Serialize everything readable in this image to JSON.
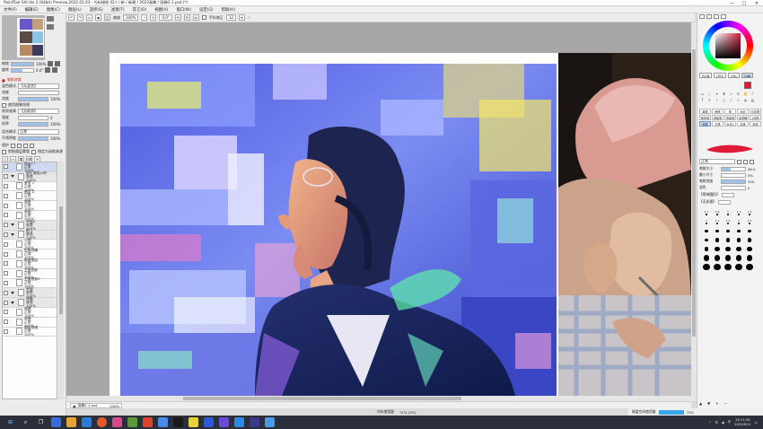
{
  "titlebar": {
    "title": "PaintTool SAI Ver.2 (64bit) Preview.2022.01.03 - 光标描绘 (D:) / 新 / 新建 / 2022画稿 / 画稿2-1.psd (*)",
    "minimize": "—",
    "maximize": "□",
    "close": "✕"
  },
  "menu": [
    "文件(F)",
    "编辑(E)",
    "图像(C)",
    "图层(L)",
    "选择(S)",
    "滤镜(T)",
    "其它(O)",
    "视图(V)",
    "窗口(W)",
    "设定(G)",
    "帮助(H)"
  ],
  "toolbar": {
    "zoom_label": "缩放",
    "zoom_value": "100%",
    "angle_value": "0.0°",
    "stabilizer_label": "手抖修正",
    "stabilizer_value": "12"
  },
  "left_panel": {
    "rows": [
      {
        "label": "缩放",
        "value": "100%"
      },
      {
        "label": "旋转",
        "value": "0.0°"
      }
    ],
    "brush_header": "笔刷浓度",
    "settings": [
      {
        "label": "混色模式",
        "value": "【无混合】"
      },
      {
        "label": "浓度",
        "value": ""
      },
      {
        "label": "浓度",
        "value": "100%"
      },
      {
        "label": "使用图像纹理",
        "value": ""
      },
      {
        "label": "纸质效果",
        "value": "【无纸质】"
      },
      {
        "label": "强度",
        "value": "0"
      },
      {
        "label": "倍率",
        "value": "100%"
      },
      {
        "label": "混合模式",
        "value": "正常"
      },
      {
        "label": "不透明度",
        "value": "100%"
      }
    ],
    "protect_label": "保护",
    "clip_button": "剪贴图层蒙版",
    "select_source_button": "指定为选取来源",
    "layers": [
      {
        "name": "图层17",
        "mode": "正常",
        "opacity": "100%",
        "folder": false,
        "selected": true
      },
      {
        "name": "图片流程示例",
        "mode": "穿透",
        "opacity": "100%",
        "folder": true,
        "selected": false
      },
      {
        "name": "参考 1",
        "mode": "正常",
        "opacity": "100%",
        "folder": false,
        "selected": false
      },
      {
        "name": "图层 2",
        "mode": "正常",
        "opacity": "100%",
        "folder": false,
        "selected": false
      },
      {
        "name": "效果",
        "mode": "正常",
        "opacity": "100%",
        "folder": false,
        "selected": false
      },
      {
        "name": "草图",
        "mode": "正常",
        "opacity": "100%",
        "folder": false,
        "selected": false
      },
      {
        "name": "草图2",
        "mode": "穿透",
        "opacity": "100%",
        "folder": true,
        "selected": false
      },
      {
        "name": "组 1",
        "mode": "穿透",
        "opacity": "100%",
        "folder": true,
        "selected": false
      },
      {
        "name": "人物",
        "mode": "正常",
        "opacity": "100%",
        "folder": false,
        "selected": false
      },
      {
        "name": "铅笔线稿",
        "mode": "正常",
        "opacity": "100%",
        "folder": false,
        "selected": false
      },
      {
        "name": "新建图层",
        "mode": "正常",
        "opacity": "100%",
        "folder": false,
        "selected": false
      },
      {
        "name": "主要投影",
        "mode": "正常",
        "opacity": "100%",
        "folder": false,
        "selected": false
      },
      {
        "name": "主要投影2",
        "mode": "正常",
        "opacity": "100%",
        "folder": false,
        "selected": false
      },
      {
        "name": "草图",
        "mode": "穿透",
        "opacity": "100%",
        "folder": true,
        "selected": false
      },
      {
        "name": "线稿",
        "mode": "穿透",
        "opacity": "100%",
        "folder": true,
        "selected": false
      },
      {
        "name": "线稿",
        "mode": "正常",
        "opacity": "100%",
        "folder": false,
        "selected": false
      },
      {
        "name": "草稿",
        "mode": "正常",
        "opacity": "100%",
        "folder": false,
        "selected": false
      },
      {
        "name": "图层纹理",
        "mode": "正常",
        "opacity": "100%",
        "folder": false,
        "selected": false
      }
    ]
  },
  "document_tab": {
    "name": "画稿2-1.psd",
    "zoom": "100%"
  },
  "status": {
    "memory_label": "内存使用量",
    "memory_value": "71% (2%)",
    "drive_label": "磁盘空间使用量",
    "drive_value": "72%"
  },
  "right_panel": {
    "mode_buttons": [
      "RGB",
      "HSV",
      "HSL",
      "Lab"
    ],
    "active_mode": "Lab",
    "brushes": [
      {
        "name": "钢笔",
        "on": false
      },
      {
        "name": "喷枪",
        "on": false
      },
      {
        "name": "笔",
        "on": false
      },
      {
        "name": "水彩",
        "on": false
      },
      {
        "name": "马克笔",
        "on": false
      },
      {
        "name": "橡皮擦",
        "on": false
      },
      {
        "name": "选择笔",
        "on": false
      },
      {
        "name": "选择擦",
        "on": false
      },
      {
        "name": "油漆桶",
        "on": false
      },
      {
        "name": "2值笔",
        "on": false
      },
      {
        "name": "铅笔",
        "on": true
      },
      {
        "name": "平笔",
        "on": false
      },
      {
        "name": "水彩2",
        "on": false
      },
      {
        "name": "涂抹",
        "on": false
      },
      {
        "name": "渐变",
        "on": false
      }
    ],
    "brush_mode": "正常",
    "params": [
      {
        "label": "笔刷大小",
        "value": "46.0"
      },
      {
        "label": "最小尺寸",
        "value": "0%"
      },
      {
        "label": "笔刷浓度",
        "value": "100"
      },
      {
        "label": "混色",
        "value": "0"
      }
    ],
    "shape_label": "【简单圆形】",
    "texture_label": "【无纹理】",
    "brush_sizes": [
      "0.7",
      "0.8",
      "1",
      "1.3",
      "1.5",
      "2",
      "2.3",
      "2.6",
      "3",
      "3.5",
      "4",
      "5",
      "6",
      "7",
      "8",
      "9",
      "10",
      "12",
      "14",
      "16",
      "20",
      "25",
      "30",
      "35",
      "40",
      "50",
      "60",
      "70",
      "80",
      "100",
      "120",
      "160",
      "200",
      "250",
      "300"
    ]
  },
  "taskbar": {
    "time": "20:11:54",
    "date": "2022/6/11",
    "lang": "中"
  }
}
